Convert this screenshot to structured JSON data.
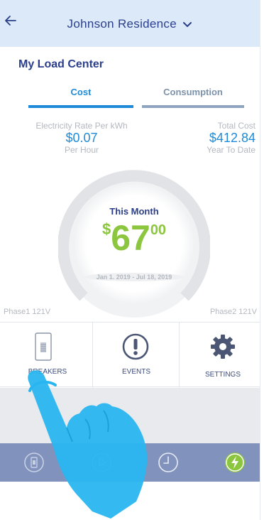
{
  "header": {
    "back_icon": "arrow-left-icon",
    "title": "Johnson Residence",
    "dropdown_icon": "chevron-down-icon"
  },
  "section": {
    "title": "My Load Center"
  },
  "tabs": [
    {
      "label": "Cost",
      "active": true
    },
    {
      "label": "Consumption",
      "active": false
    }
  ],
  "stats": {
    "rate": {
      "label": "Electricity Rate Per kWh",
      "value": "$0.07",
      "sub": "Per Hour"
    },
    "total": {
      "label": "Total Cost",
      "value": "$412.84",
      "sub": "Year To Date"
    }
  },
  "gauge": {
    "title": "This Month",
    "amount_symbol": "$",
    "amount_int": "67",
    "amount_dec": "00",
    "range": "Jan 1. 2019 - Jul 18, 2019"
  },
  "phases": {
    "left": "Phase1 121V",
    "right": "Phase2 121V"
  },
  "actions": [
    {
      "label": "BREAKERS",
      "icon": "breaker-panel-icon"
    },
    {
      "label": "EVENTS",
      "icon": "exclamation-circle-icon"
    },
    {
      "label": "SETTINGS",
      "icon": "gear-icon"
    }
  ],
  "tabbar": [
    {
      "icon": "breaker-icon"
    },
    {
      "icon": "play-icon"
    },
    {
      "icon": "clock-icon"
    },
    {
      "icon": "lightning-icon",
      "active": true
    }
  ],
  "colors": {
    "accent": "#1f8bd8",
    "brand": "#2c3f8c",
    "amount": "#8cc63f",
    "tabbar": "#8192bc",
    "hand": "#29b6f0"
  }
}
